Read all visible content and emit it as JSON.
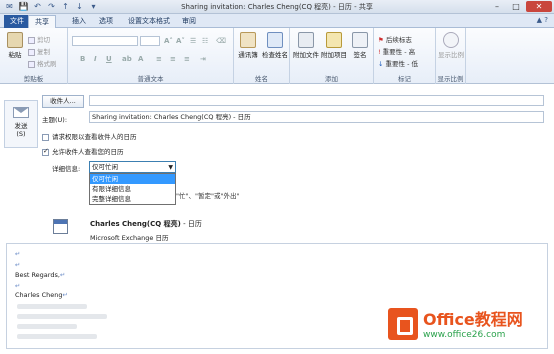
{
  "window": {
    "title": "Sharing invitation: Charles Cheng(CQ 程亮) - 日历  -  共享",
    "controls": [
      "–",
      "□",
      "✕"
    ]
  },
  "tabs": [
    {
      "label": "文件"
    },
    {
      "label": "共享"
    },
    {
      "label": "插入"
    },
    {
      "label": "选项"
    },
    {
      "label": "设置文本格式"
    },
    {
      "label": "审阅"
    }
  ],
  "ribbon": {
    "clipboard": {
      "paste": "粘贴",
      "cut": "剪切",
      "copy": "复制",
      "format_painter": "格式刷",
      "label": "剪贴板"
    },
    "basic_text": {
      "label": "普通文本"
    },
    "names": {
      "address_book": "通讯簿",
      "check_names": "检查姓名",
      "label": "姓名"
    },
    "include": {
      "attach_file": "附加文件",
      "attach_item": "附加项目",
      "signature": "签名",
      "label": "添加"
    },
    "tags": {
      "follow_up": "后续标志",
      "high_importance": "重要性 - 高",
      "low_importance": "重要性 - 低",
      "label": "标记"
    },
    "zoom": {
      "zoom": "显示比例",
      "label": "显示比例"
    }
  },
  "compose": {
    "send_label": "发送",
    "send_shortcut": "(S)",
    "to_button": "收件人...",
    "subject_label": "主题(U):",
    "subject_value": "Sharing invitation: Charles Cheng(CQ 程亮) - 日历",
    "request_permission": "请求权限以查看收件人的日历",
    "allow_view": "允许收件人查看您的日历",
    "detail_label": "详细信息:",
    "detail_selected": "仅可忙闲",
    "detail_options": [
      "仅可忙闲",
      "有限详细信息",
      "完整详细信息"
    ],
    "detail_hint": "\"忙\"、\"暂定\"或\"外出\""
  },
  "calendar": {
    "name": "Charles Cheng(CQ 程亮)",
    "name_suffix": " - 日历",
    "source": "Microsoft Exchange 日历"
  },
  "body": {
    "regards": "Best Regards,",
    "signature_name": "Charles Cheng"
  },
  "watermark": {
    "title": "Office教程网",
    "url": "www.office26.com"
  },
  "colors": {
    "file_tab": "#2a5aa0",
    "selection": "#3399ff",
    "watermark_orange": "#e8541e",
    "watermark_green": "#2ba24c"
  }
}
